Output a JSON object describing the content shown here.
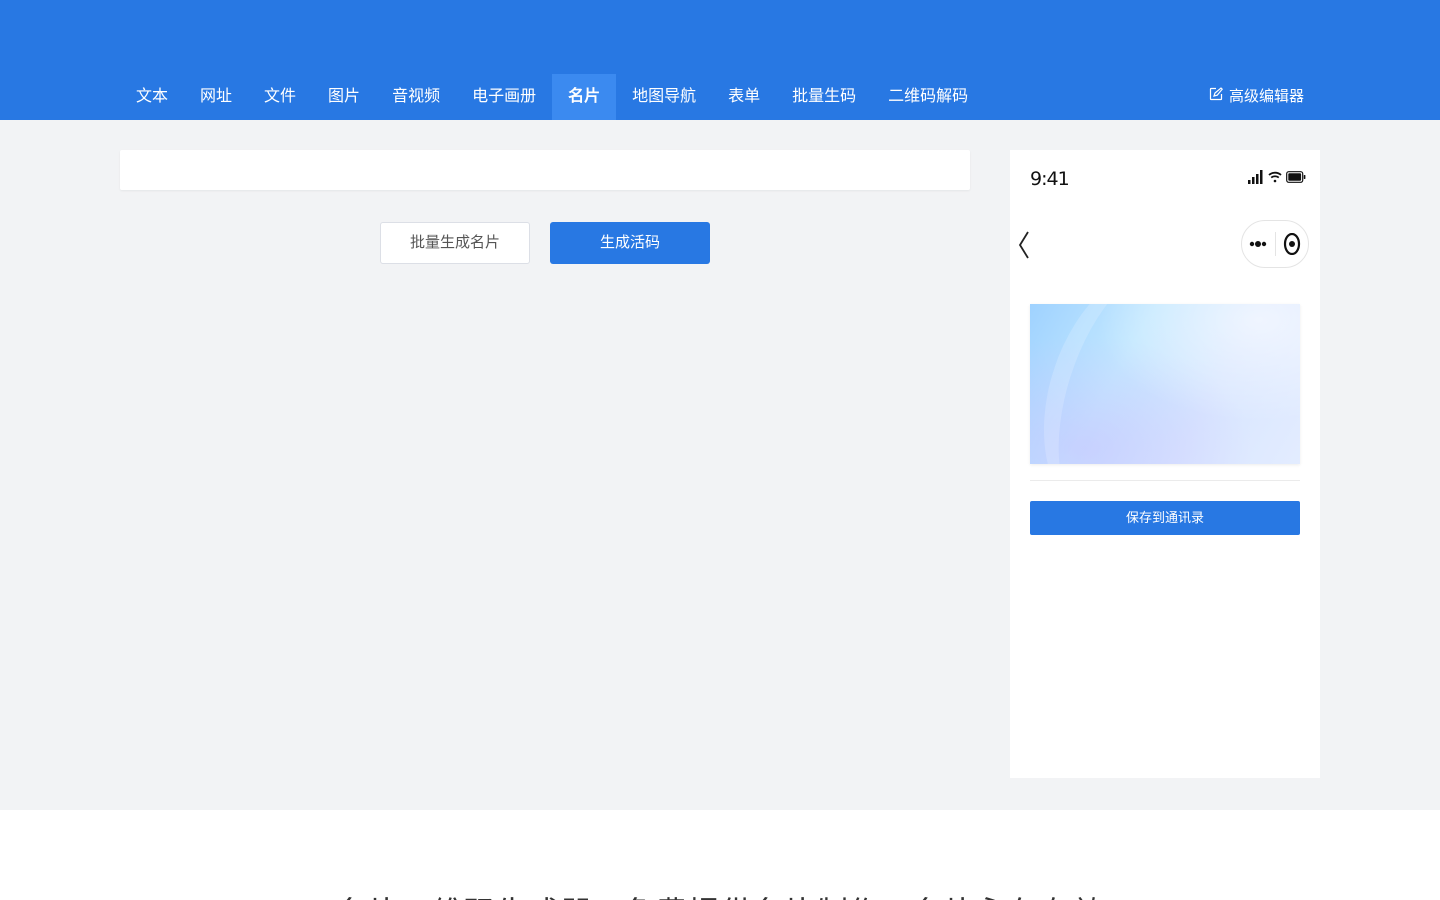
{
  "nav": {
    "items": [
      {
        "label": "文本"
      },
      {
        "label": "网址"
      },
      {
        "label": "文件"
      },
      {
        "label": "图片"
      },
      {
        "label": "音视频"
      },
      {
        "label": "电子画册"
      },
      {
        "label": "名片"
      },
      {
        "label": "地图导航"
      },
      {
        "label": "表单"
      },
      {
        "label": "批量生码"
      },
      {
        "label": "二维码解码"
      }
    ],
    "active_index": 6,
    "advanced_editor_label": "高级编辑器"
  },
  "actions": {
    "batch_label": "批量生成名片",
    "generate_label": "生成活码"
  },
  "phone_preview": {
    "status_time": "9:41",
    "save_contact_label": "保存到通讯录"
  },
  "footer": {
    "title": "名片二维码生成器，免费提供名片制作，名片永久有效"
  },
  "colors": {
    "primary": "#2878e3",
    "active_tab": "#3b8af0",
    "background": "#f2f3f5"
  }
}
